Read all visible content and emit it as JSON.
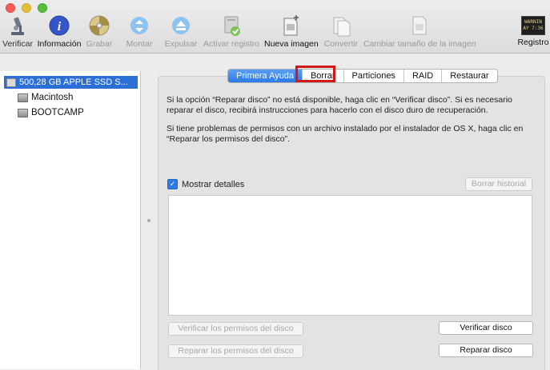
{
  "toolbar": {
    "items": [
      {
        "label": "Verificar",
        "icon": "microscope-icon"
      },
      {
        "label": "Información",
        "icon": "info-icon"
      },
      {
        "label": "Grabar",
        "icon": "burn-disc-icon"
      },
      {
        "label": "Montar",
        "icon": "mount-icon"
      },
      {
        "label": "Expulsar",
        "icon": "eject-icon"
      },
      {
        "label": "Activar registro",
        "icon": "enable-journaling-icon"
      },
      {
        "label": "Nueva imagen",
        "icon": "new-image-icon"
      },
      {
        "label": "Convertir",
        "icon": "convert-icon"
      },
      {
        "label": "Cambiar tamaño de la imagen",
        "icon": "resize-image-icon"
      },
      {
        "label": "Registro",
        "icon": "log-icon"
      }
    ],
    "log_icon_text": [
      "WARNIN",
      "AY 7:36"
    ]
  },
  "sidebar": {
    "disk": "500,28 GB APPLE SSD S...",
    "volumes": [
      "Macintosh",
      "BOOTCAMP"
    ]
  },
  "tabs": [
    "Primera Ayuda",
    "Borrar",
    "Particiones",
    "RAID",
    "Restaurar"
  ],
  "first_aid": {
    "para1": "Si la opción “Reparar disco” no está disponible, haga clic en “Verificar disco”. Si es necesario reparar el disco, recibirá instrucciones para hacerlo con el disco duro de recuperación.",
    "para2": "Si tiene problemas de permisos con un archivo instalado por el instalador de OS X, haga clic en “Reparar los permisos del disco”.",
    "show_details": "Mostrar detalles",
    "clear_history": "Borrar historial",
    "verify_permissions": "Verificar los permisos del disco",
    "repair_permissions": "Reparar los permisos del disco",
    "verify_disk": "Verificar disco",
    "repair_disk": "Reparar disco"
  },
  "colors": {
    "selection": "#2b6fd6",
    "tab_active": "#2a79e8",
    "highlight_box": "#d01a1a"
  }
}
